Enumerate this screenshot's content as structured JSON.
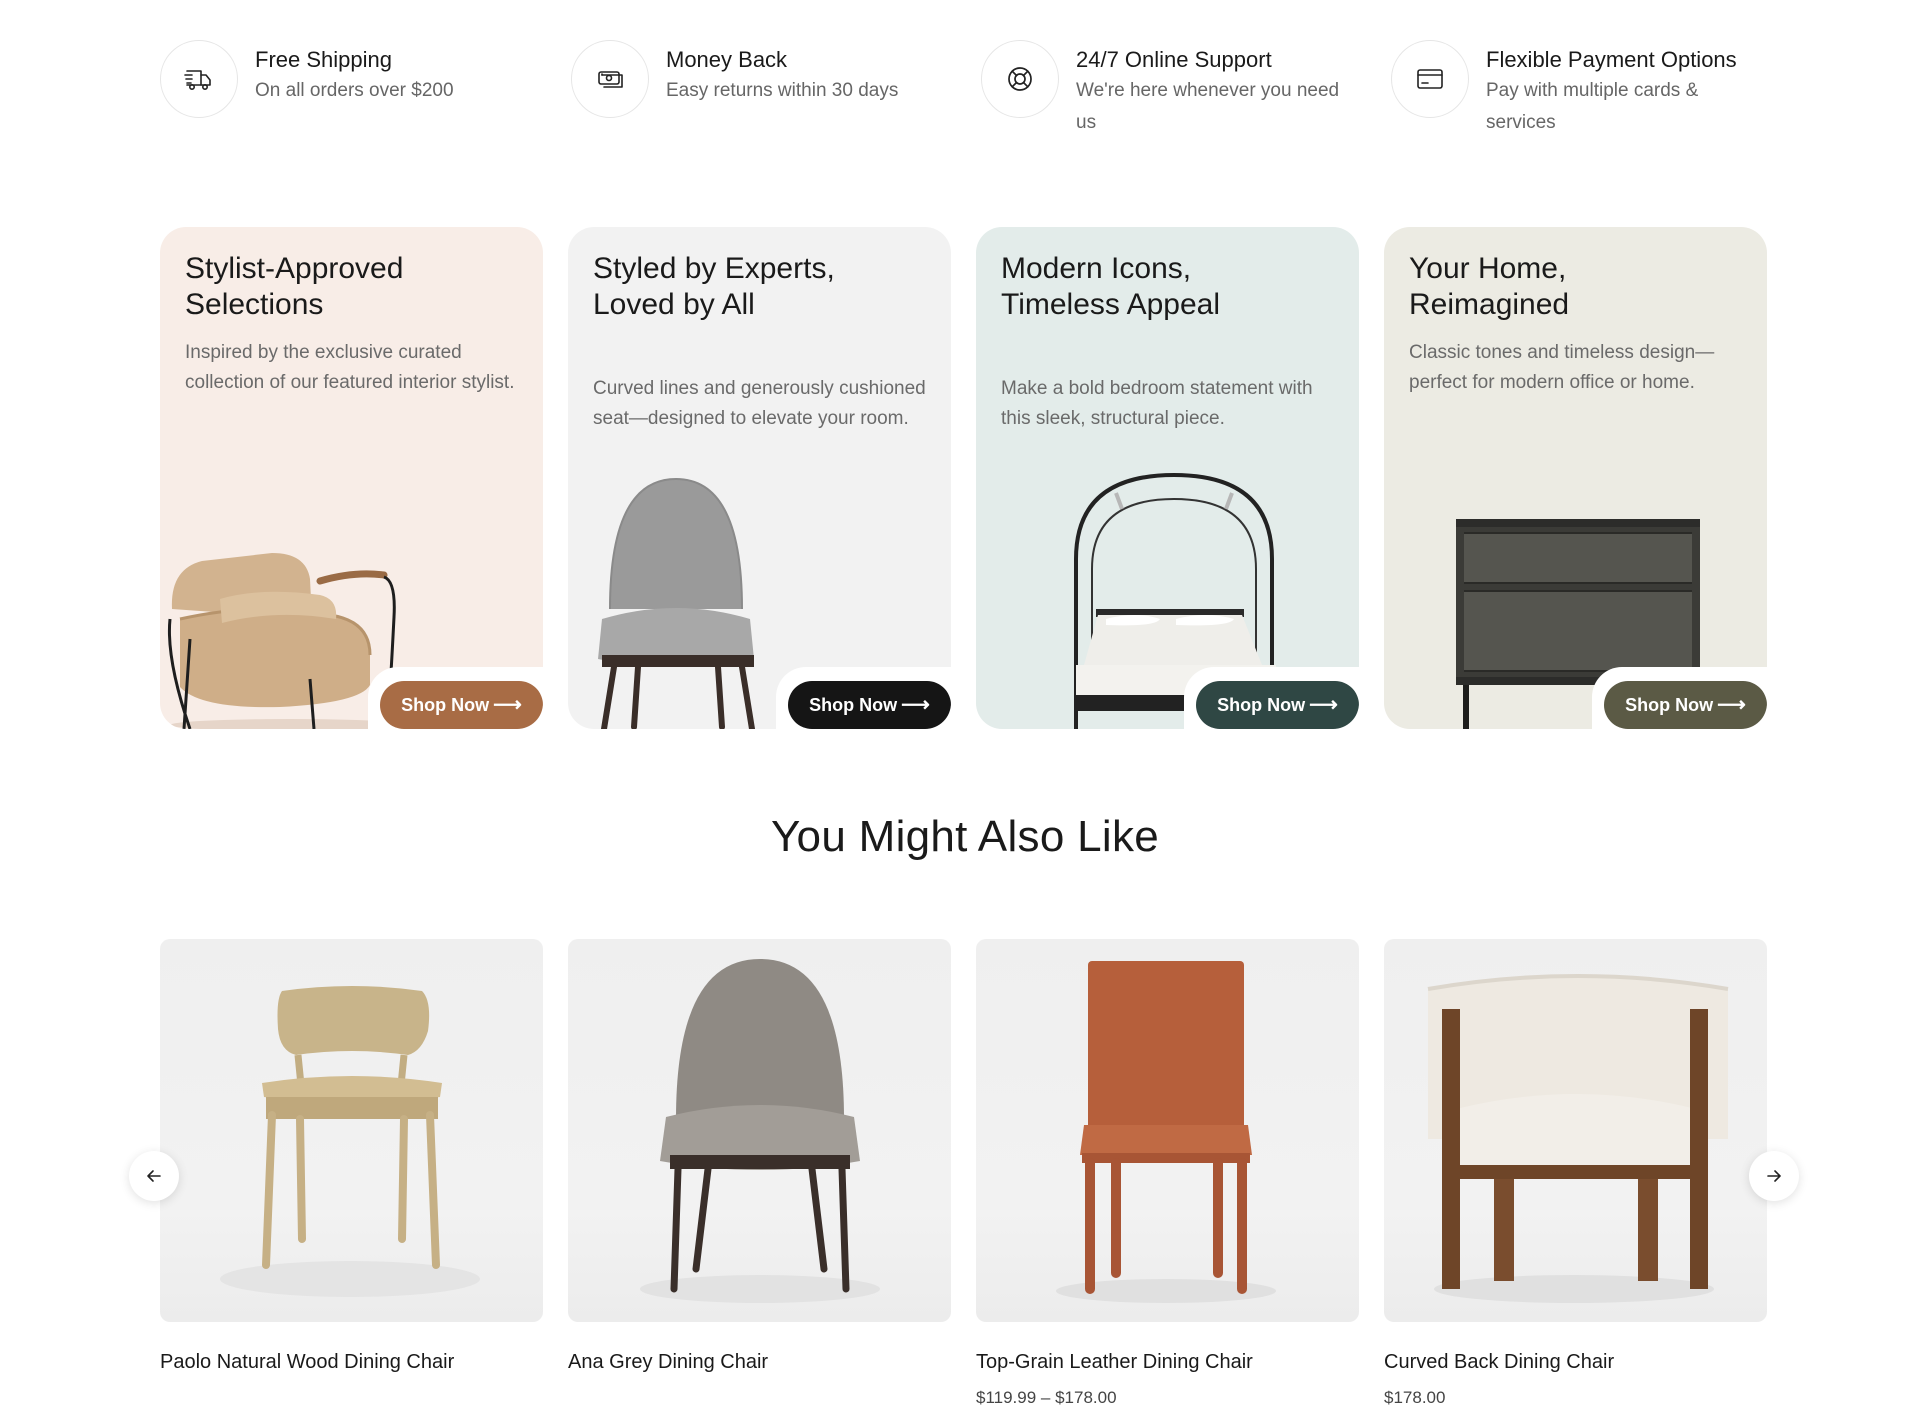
{
  "features": [
    {
      "icon": "truck-icon",
      "title": "Free Shipping",
      "subtitle": "On all orders over $200"
    },
    {
      "icon": "money-icon",
      "title": "Money Back",
      "subtitle": "Easy returns within 30 days"
    },
    {
      "icon": "lifebuoy-icon",
      "title": "24/7 Online Support",
      "subtitle": "We're here whenever you need us"
    },
    {
      "icon": "credit-card-icon",
      "title": "Flexible Payment Options",
      "subtitle": "Pay with multiple cards & services"
    }
  ],
  "promos": [
    {
      "title": "Stylist-Approved Selections",
      "description": "Inspired by the exclusive curated collection of our featured interior stylist.",
      "button": "Shop Now",
      "button_color": "#a86c45"
    },
    {
      "title": "Styled by Experts, Loved by All",
      "description": "Curved lines and generously cushioned seat—designed to elevate your room.",
      "button": "Shop Now",
      "button_color": "#151515"
    },
    {
      "title": "Modern Icons, Timeless Appeal",
      "description": "Make a bold bedroom statement with this sleek, structural piece.",
      "button": "Shop Now",
      "button_color": "#2f4744"
    },
    {
      "title": "Your Home, Reimagined",
      "description": "Classic tones and timeless design—perfect for modern office or home.",
      "button": "Shop Now",
      "button_color": "#5b5a45"
    }
  ],
  "section_title": "You Might Also Like",
  "products": [
    {
      "name": "Paolo Natural Wood Dining Chair",
      "price": ""
    },
    {
      "name": "Ana Grey Dining Chair",
      "price": ""
    },
    {
      "name": "Top-Grain Leather Dining Chair",
      "price": "$119.99 – $178.00"
    },
    {
      "name": "Curved Back Dining Chair",
      "price": "$178.00"
    }
  ],
  "carousel": {
    "prev_icon": "arrow-left-icon",
    "next_icon": "arrow-right-icon"
  }
}
